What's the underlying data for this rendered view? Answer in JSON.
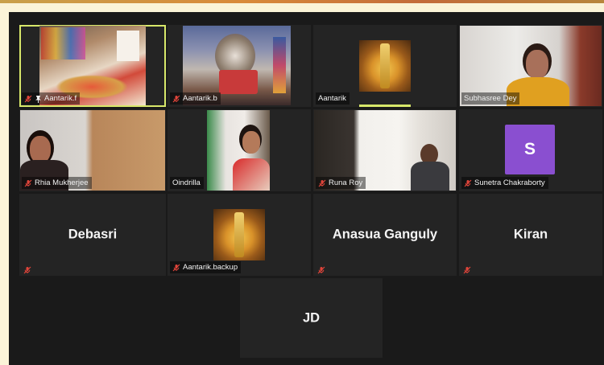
{
  "meeting": {
    "participants": [
      {
        "id": "p1",
        "name": "Aantarik.f",
        "muted": true,
        "pinned": true,
        "active": true,
        "video": true
      },
      {
        "id": "p2",
        "name": "Aantarik.b",
        "muted": true,
        "video": true
      },
      {
        "id": "p3",
        "name": "Aantarik",
        "muted": false,
        "video": true
      },
      {
        "id": "p4",
        "name": "Subhasree Dey",
        "muted": false,
        "video": true
      },
      {
        "id": "p5",
        "name": "Rhia Mukherjee",
        "muted": true,
        "video": true
      },
      {
        "id": "p6",
        "name": "Oindrilla",
        "muted": false,
        "video": true
      },
      {
        "id": "p7",
        "name": "Runa Roy",
        "muted": true,
        "video": true
      },
      {
        "id": "p8",
        "name": "Sunetra Chakraborty",
        "muted": true,
        "video": false,
        "avatar_letter": "S",
        "avatar_color": "#8a4fd0"
      },
      {
        "id": "p9",
        "name": "Debasri",
        "muted": true,
        "video": false
      },
      {
        "id": "p10",
        "name": "Aantarik.backup",
        "muted": true,
        "video": true
      },
      {
        "id": "p11",
        "name": "Anasua Ganguly",
        "muted": true,
        "video": false
      },
      {
        "id": "p12",
        "name": "Kiran",
        "muted": true,
        "video": false
      },
      {
        "id": "p13",
        "name": "JD",
        "muted": false,
        "video": false
      }
    ]
  },
  "colors": {
    "active_speaker_border": "#d8e86a",
    "tile_background": "#242424",
    "stage_background": "#1a1a1a",
    "muted_icon": "#e0443a"
  },
  "icons": {
    "muted": "mic-off-icon",
    "pinned": "pin-icon"
  }
}
